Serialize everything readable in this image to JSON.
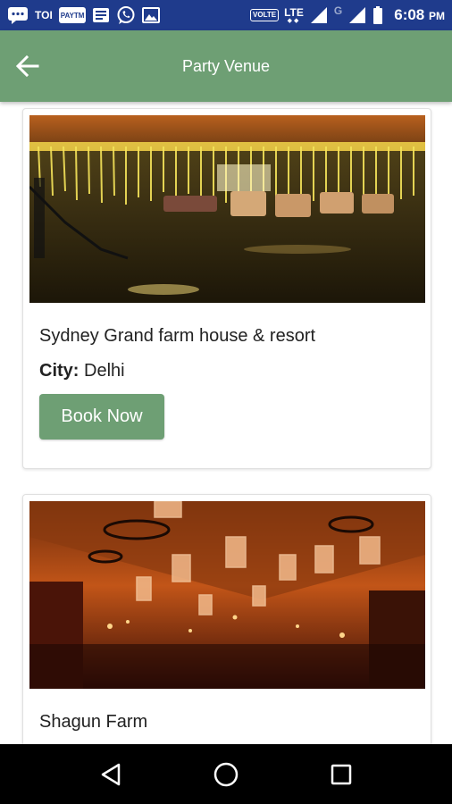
{
  "status_bar": {
    "left_icons": [
      "message-icon",
      "toi-app-icon",
      "paytm-app-icon",
      "news-icon",
      "whatsapp-icon",
      "gallery-icon"
    ],
    "toi_label": "TOI",
    "paytm_label": "PAYTM",
    "volte_label": "VOLTE",
    "network_label": "LTE",
    "sim2_label": "G",
    "time": "6:08",
    "ampm": "PM"
  },
  "toolbar": {
    "title": "Party Venue",
    "background": "#6e9f74"
  },
  "venues": [
    {
      "name": "Sydney Grand farm house & resort",
      "city_label": "City:",
      "city": "Delhi",
      "book_label": "Book Now"
    },
    {
      "name": "Shagun Farm"
    }
  ],
  "nav_bar": {
    "buttons": [
      "back-triangle-icon",
      "home-circle-icon",
      "recents-square-icon"
    ]
  },
  "colors": {
    "status_bar": "#1f3b8c",
    "accent": "#6e9f74",
    "text": "#222222"
  }
}
